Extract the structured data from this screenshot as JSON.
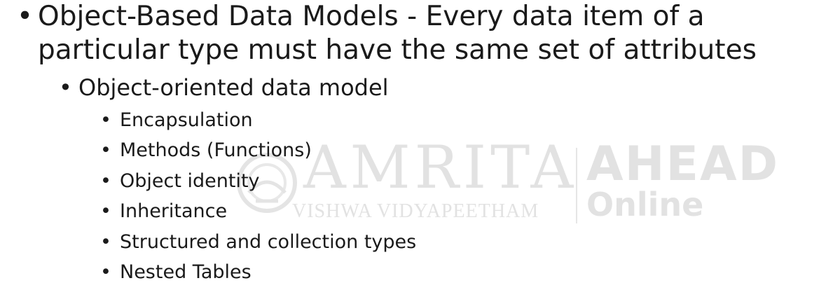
{
  "slide": {
    "main_bullet": {
      "line1": "Object-Based Data Models - Every data item of a",
      "line2": "particular type must have the same set of attributes"
    },
    "sub_bullet": "Object-oriented data model",
    "sub_items": [
      "Encapsulation",
      "Methods (Functions)",
      "Object identity",
      "Inheritance",
      "Structured and collection types",
      "Nested Tables"
    ],
    "bullet_glyph": "•"
  },
  "watermark": {
    "brand": "AMRITA",
    "tagline": "VISHWA VIDYAPEETHAM",
    "ahead": "AHEAD",
    "online": "Online",
    "color": "#e2e2e2"
  }
}
